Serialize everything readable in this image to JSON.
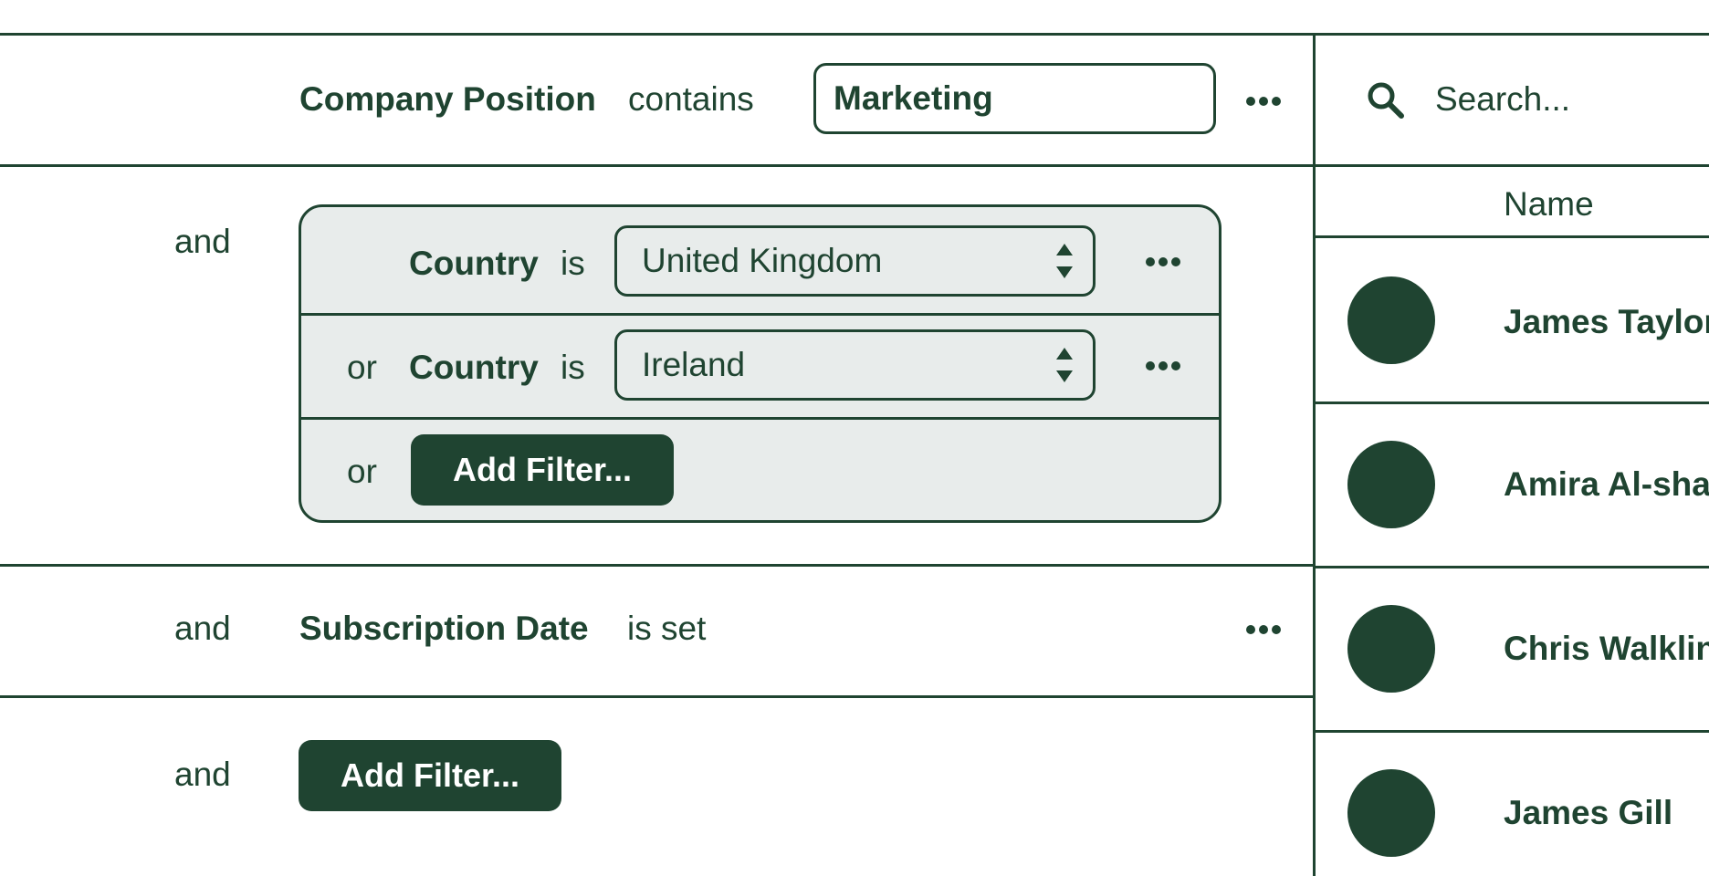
{
  "filters": {
    "row1": {
      "field": "Company Position",
      "operator": "contains",
      "value": "Marketing"
    },
    "row2": {
      "conjunction": "and",
      "group": [
        {
          "conjunction": "",
          "field": "Country",
          "operator": "is",
          "value": "United Kingdom"
        },
        {
          "conjunction": "or",
          "field": "Country",
          "operator": "is",
          "value": "Ireland"
        }
      ],
      "add_conjunction": "or",
      "add_label": "Add Filter..."
    },
    "row3": {
      "conjunction": "and",
      "field": "Subscription Date",
      "operator": "is set"
    },
    "row4": {
      "conjunction": "and",
      "add_label": "Add Filter..."
    }
  },
  "results": {
    "search_placeholder": "Search...",
    "column_header": "Name",
    "people": [
      {
        "name": "James Taylor"
      },
      {
        "name": "Amira Al-sha"
      },
      {
        "name": "Chris Walkline"
      },
      {
        "name": "James Gill"
      }
    ]
  },
  "colors": {
    "primary": "#1f4431",
    "group_background": "#e8eceb",
    "background": "#ffffff"
  },
  "icons": [
    "search-icon",
    "more-icon",
    "stepper-icon"
  ]
}
